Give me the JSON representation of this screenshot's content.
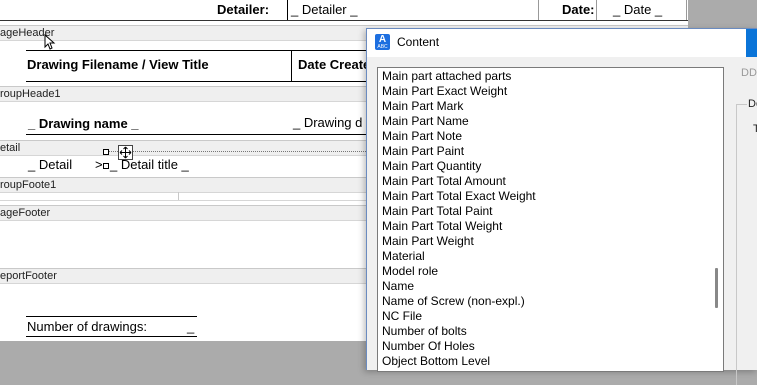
{
  "report": {
    "top_row": {
      "detailer_label": "Detailer:",
      "detailer_value": "_ Detailer _",
      "date_label": "Date:",
      "date_value": "_ Date _"
    },
    "bands": {
      "page_header": "ageHeader",
      "group_header": "roupHeade1",
      "detail": "etail",
      "group_footer": "roupFoote1",
      "page_footer": "ageFooter",
      "report_footer": "eportFooter"
    },
    "columns": {
      "drawing_filename": "Drawing Filename / View Title",
      "date_created": "Date Create"
    },
    "group_row": {
      "drawing_name": "_ Drawing name _",
      "drawing_date": "_ Drawing d"
    },
    "detail_row": {
      "detail": "_ Detail",
      "detail_title": "_ Detail title _",
      "arrow": ">"
    },
    "footer": {
      "number_of_drawings_label": "Number of drawings:",
      "number_of_drawings_value": "_"
    }
  },
  "dialog": {
    "title": "Content",
    "icon": "app-icon",
    "accent_color": "#0a74d8",
    "list_items": [
      "Main part attached parts",
      "Main Part Exact Weight",
      "Main Part Mark",
      "Main Part Name",
      "Main Part Note",
      "Main Part Paint",
      "Main Part Quantity",
      "Main Part Total Amount",
      "Main Part Total Exact Weight",
      "Main Part Total Paint",
      "Main Part Total Weight",
      "Main Part Weight",
      "Material",
      "Model role",
      "Name",
      "Name of Screw (non-expl.)",
      "NC File",
      "Number of bolts",
      "Number Of Holes",
      "Object Bottom Level"
    ],
    "side_top_label": "DD",
    "side_group_label": "De",
    "side_t_label": "T"
  }
}
